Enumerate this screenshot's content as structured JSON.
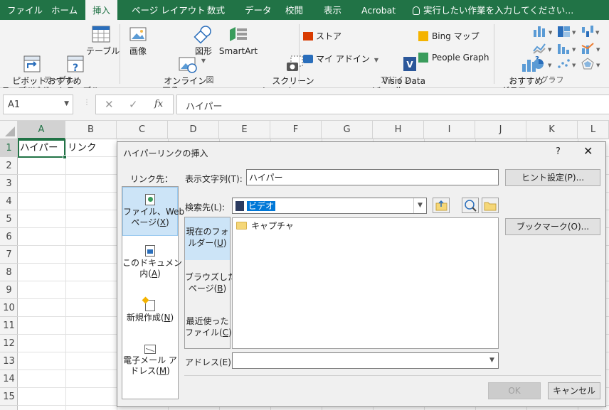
{
  "ribbon_tabs": [
    "ファイル",
    "ホーム",
    "挿入",
    "ページ レイアウト",
    "数式",
    "データ",
    "校閲",
    "表示",
    "Acrobat"
  ],
  "active_tab": "挿入",
  "tell_me": "実行したい作業を入力してください...",
  "ribbon": {
    "pivot_table": "ピボット\nテーブル",
    "recommended_pivot": "おすすめ\nピボットテーブル",
    "table": "テーブル",
    "group_tables": "テーブル",
    "pictures": "画像",
    "online_pictures": "オンライン\n画像",
    "shapes": "図形",
    "smartart": "SmartArt",
    "screenshot": "スクリーン\nショット",
    "group_illustrations": "図",
    "store": "ストア",
    "my_addins": "マイ アドイン",
    "visio": "Visio Data\nVisualizer",
    "bing_maps": "Bing マップ",
    "people_graph": "People Graph",
    "group_addins": "アドイン",
    "recommended_charts": "おすすめ\nグラフ",
    "group_charts": "グラフ"
  },
  "name_box": "A1",
  "formula_value": "ハイパー",
  "columns": [
    "A",
    "B",
    "C",
    "D",
    "E",
    "F",
    "G",
    "H",
    "I",
    "J",
    "K",
    "L"
  ],
  "rows": [
    "1",
    "2",
    "3",
    "4",
    "5",
    "6",
    "7",
    "8",
    "9",
    "10",
    "11",
    "12",
    "13",
    "14",
    "15"
  ],
  "cells": {
    "A1": "ハイパー",
    "B1": "リンク"
  },
  "dialog": {
    "title": "ハイパーリンクの挿入",
    "help": "?",
    "link_to_label": "リンク先：",
    "link_items": [
      {
        "pre": "ファイル、Web\nページ(",
        "key": "X",
        "post": ")"
      },
      {
        "pre": "このドキュメント\n内(",
        "key": "A",
        "post": ")"
      },
      {
        "pre": "新規作成(",
        "key": "N",
        "post": ")"
      },
      {
        "pre": "電子メール ア\nドレス(",
        "key": "M",
        "post": ")"
      }
    ],
    "display_text_label": "表示文字列(T):",
    "display_text_value": "ハイパー",
    "screentip_button": "ヒント設定(P)...",
    "look_in_label": "検索先(L):",
    "look_in_value": "ビデオ",
    "nav_items": [
      {
        "pre": "現在のフォ\nルダー(",
        "key": "U",
        "post": ")"
      },
      {
        "pre": "ブラウズした\nページ(",
        "key": "B",
        "post": ")"
      },
      {
        "pre": "最近使った\nファイル(",
        "key": "C",
        "post": ")"
      }
    ],
    "files": [
      "キャプチャ"
    ],
    "bookmark_button": "ブックマーク(O)...",
    "address_label": "アドレス(E):",
    "address_value": "",
    "ok_button": "OK",
    "cancel_button": "キャンセル"
  },
  "colors": {
    "excel_green": "#217346",
    "selection_blue": "#cce4f7"
  }
}
